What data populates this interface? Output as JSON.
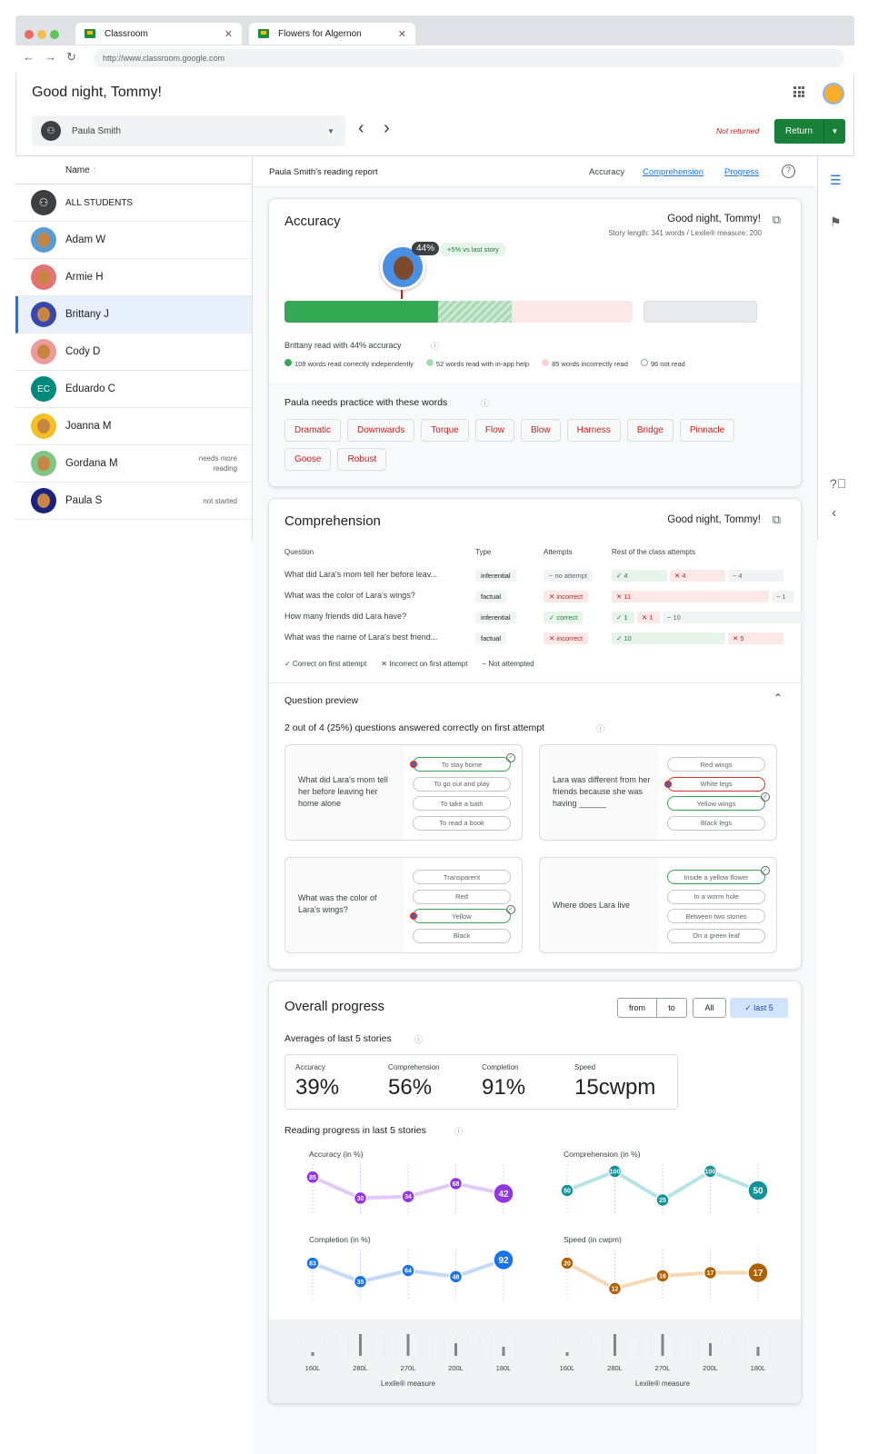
{
  "browser": {
    "tabs": [
      "Classroom",
      "Flowers for Algernon"
    ],
    "url": "http://www.classroom.google.com"
  },
  "header": {
    "greeting": "Good night, Tommy!",
    "student_select": "Paula Smith",
    "status": "Not returned",
    "return_label": "Return"
  },
  "roster": {
    "name_col": "Name",
    "all": "ALL STUDENTS",
    "students": [
      {
        "name": "Adam W",
        "note": ""
      },
      {
        "name": "Armie H",
        "note": ""
      },
      {
        "name": "Brittany J",
        "note": ""
      },
      {
        "name": "Cody D",
        "note": ""
      },
      {
        "name": "Eduardo C",
        "initials": "EC",
        "note": ""
      },
      {
        "name": "Joanna M",
        "note": ""
      },
      {
        "name": "Gordana M",
        "note": "needs more reading"
      },
      {
        "name": "Paula S",
        "note": "not started"
      }
    ]
  },
  "report": {
    "title": "Paula Smith's reading report",
    "tabs": [
      "Accuracy",
      "Comprehension",
      "Progress"
    ]
  },
  "accuracy": {
    "title": "Accuracy",
    "story": "Good night, Tommy!",
    "story_meta": "Story length: 341 words / Lexile® measure: 200",
    "pct": "44%",
    "delta": "+5% vs last story",
    "summary": "Brittany read with 44% accuracy",
    "legend": [
      "108 words read correctly independently",
      "52 words read with in-app help",
      "85 words incorrectly read",
      "96 not read"
    ],
    "bar": {
      "correct": 108,
      "helped": 52,
      "incorrect": 85,
      "not_read": 96
    },
    "practice_title": "Paula needs practice with these words",
    "words": [
      "Dramatic",
      "Downwards",
      "Torque",
      "Flow",
      "Blow",
      "Harness",
      "Bridge",
      "Pinnacle",
      "Goose",
      "Robust"
    ]
  },
  "comprehension": {
    "title": "Comprehension",
    "story": "Good night, Tommy!",
    "cols": [
      "Question",
      "Type",
      "Attempts",
      "Rest of the class attempts"
    ],
    "rows": [
      {
        "q": "What did Lara's mom tell her before leav...",
        "type": "inferential",
        "attempt": "− no attempt",
        "ac": "gray",
        "r": [
          "✓ 4",
          "✕ 4",
          "− 4"
        ]
      },
      {
        "q": "What was the color of Lara's wings?",
        "type": "factual",
        "attempt": "✕ incorrect",
        "ac": "red",
        "r": [
          "✕ 11",
          "− 1"
        ]
      },
      {
        "q": "How many friends did Lara have?",
        "type": "inferential",
        "attempt": "✓ correct",
        "ac": "green",
        "r": [
          "✓ 1",
          "✕ 1",
          "− 10"
        ]
      },
      {
        "q": "What was the name of Lara's best friend...",
        "type": "factual",
        "attempt": "✕ incorrect",
        "ac": "red",
        "r": [
          "✓ 10",
          "✕ 5"
        ]
      }
    ],
    "legend": [
      "✓ Correct on first attempt",
      "✕ Incorrect on first attempt",
      "− Not attempted"
    ],
    "preview_title": "Question preview",
    "preview_summary": "2 out of 4 (25%) questions answered correctly on first attempt",
    "questions": [
      {
        "text": "What did Lara's mom tell her before leaving her home alone",
        "options": [
          "To stay home",
          "To go out and play",
          "To take a bath",
          "To read a book"
        ]
      },
      {
        "text": "Lara was different from her friends because she was having ______",
        "options": [
          "Red wings",
          "White legs",
          "Yellow wings",
          "Black legs"
        ]
      },
      {
        "text": "What was the color of Lara's wings?",
        "options": [
          "Transparent",
          "Red",
          "Yellow",
          "Black"
        ]
      },
      {
        "text": "Where does Lara live",
        "options": [
          "Inside a yellow flower",
          "In a worm hole",
          "Between two stones",
          "On a green leaf"
        ]
      }
    ]
  },
  "progress": {
    "title": "Overall progress",
    "filters": [
      "from",
      "to",
      "All",
      "✓ last 5"
    ],
    "avg_title": "Averages of last 5 stories",
    "averages": [
      {
        "label": "Accuracy",
        "value": "39%"
      },
      {
        "label": "Comprehension",
        "value": "56%"
      },
      {
        "label": "Completion",
        "value": "91%"
      },
      {
        "label": "Speed",
        "value": "15cwpm"
      }
    ],
    "reading_title": "Reading progress in last 5 stories",
    "lexile": [
      "160L",
      "280L",
      "270L",
      "200L",
      "180L"
    ],
    "lexile_label": "Lexile® measure"
  },
  "chart_data": [
    {
      "type": "line",
      "title": "Accuracy (in %)",
      "values": [
        85,
        30,
        34,
        68,
        42
      ],
      "color": "#9334e6"
    },
    {
      "type": "line",
      "title": "Comprehension (in %)",
      "values": [
        50,
        100,
        25,
        100,
        50
      ],
      "color": "#12939a"
    },
    {
      "type": "line",
      "title": "Completion (in %)",
      "values": [
        83,
        35,
        64,
        48,
        92
      ],
      "color": "#1a73e8"
    },
    {
      "type": "line",
      "title": "Speed (in cwpm)",
      "values": [
        20,
        12,
        16,
        17,
        17
      ],
      "color": "#b06000"
    }
  ]
}
